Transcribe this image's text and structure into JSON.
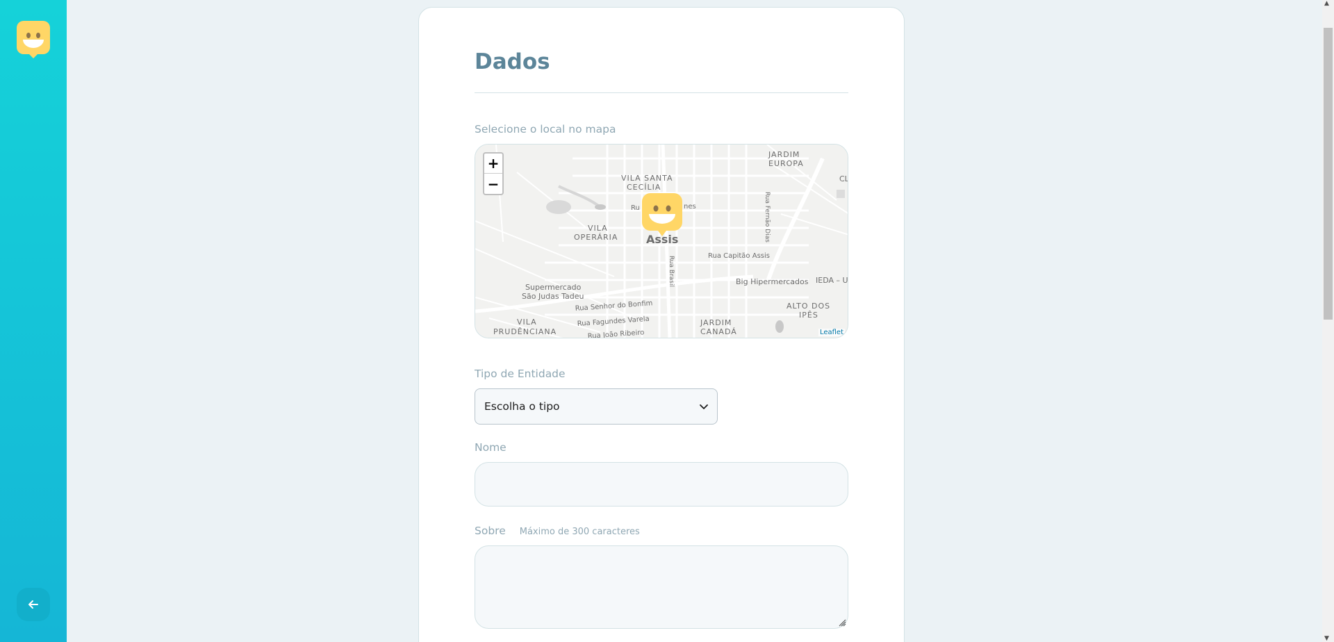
{
  "sidebar": {
    "logo_icon": "smiley-logo-icon",
    "back_icon": "arrow-left-icon"
  },
  "form": {
    "title": "Dados",
    "map_label": "Selecione o local no mapa",
    "entity_label": "Tipo de Entidade",
    "entity_value": "Escolha o tipo",
    "name_label": "Nome",
    "about_label": "Sobre",
    "about_hint": "Máximo de 300 caracteres"
  },
  "map": {
    "zoom_in": "+",
    "zoom_out": "−",
    "attribution": "Leaflet",
    "labels": {
      "vila_santa": "VILA SANTA",
      "cecilia": "CECÍLIA",
      "jardim_europa_1": "JARDIM",
      "jardim_europa_2": "EUROPA",
      "vila_operaria_1": "VILA",
      "vila_operaria_2": "OPERÁRIA",
      "assis": "Assis",
      "rua_capitao": "Rua Capitão Assis",
      "big": "Big Hipermercados",
      "ieda": "IEDA – U",
      "rua_brasil": "Rua Brasil",
      "rua_fernao": "Rua Fernão Dias",
      "rua_partial": "Ru",
      "rua_partial2": "nes",
      "super1": "Supermercado",
      "super2": "São Judas Tadeu",
      "senhor": "Rua Senhor do Bonfim",
      "fagundes": "Rua Fagundes Varela",
      "joao": "Rua João Ribeiro",
      "vila_prud_1": "VILA",
      "vila_prud_2": "PRUDÊNCIANA",
      "jardim_canada_1": "JARDIM",
      "jardim_canada_2": "CANADÁ",
      "alto_1": "ALTO DOS",
      "alto_2": "IPÊS",
      "cl": "CL"
    }
  },
  "colors": {
    "accent": "#15c3d6",
    "title": "#5c8599",
    "label": "#8fa7b3"
  }
}
